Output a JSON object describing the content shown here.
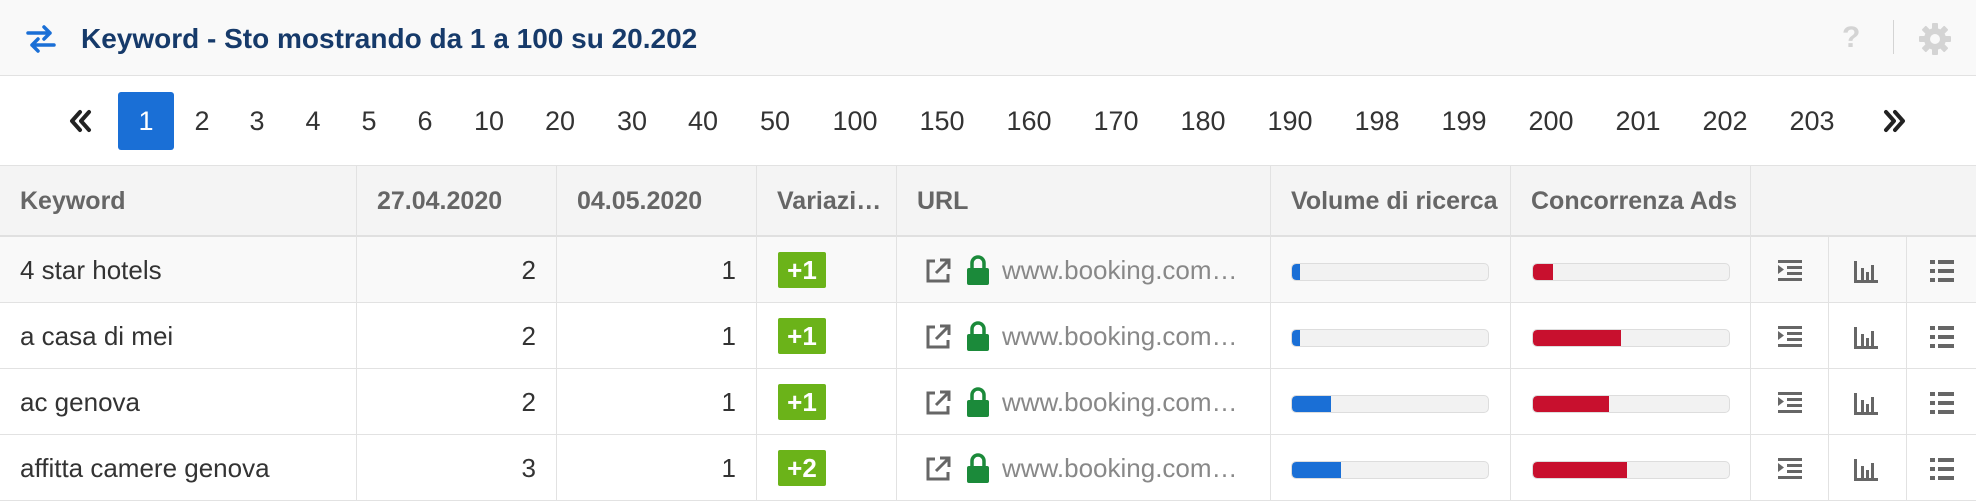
{
  "header": {
    "title": "Keyword - Sto mostrando da 1 a 100 su 20.202",
    "help": "?",
    "icons": [
      "swap-arrows-icon",
      "help-icon",
      "gear-icon"
    ]
  },
  "pagination": {
    "pages": [
      "1",
      "2",
      "3",
      "4",
      "5",
      "6",
      "10",
      "20",
      "30",
      "40",
      "50",
      "100",
      "150",
      "160",
      "170",
      "180",
      "190",
      "198",
      "199",
      "200",
      "201",
      "202",
      "203"
    ],
    "current": "1",
    "first_icon": "double-chevron-left-icon",
    "last_icon": "double-chevron-right-icon"
  },
  "table": {
    "columns": [
      "Keyword",
      "27.04.2020",
      "04.05.2020",
      "Variazione",
      "URL",
      "Volume di ricerca",
      "Concorrenza Ads"
    ],
    "rows": [
      {
        "keyword": "4 star hotels",
        "prev": "2",
        "curr": "1",
        "change": "+1",
        "url": "www.booking.com…",
        "volume": 0.04,
        "competition": 0.1
      },
      {
        "keyword": "a casa di mei",
        "prev": "2",
        "curr": "1",
        "change": "+1",
        "url": "www.booking.com…",
        "volume": 0.04,
        "competition": 0.45
      },
      {
        "keyword": "ac genova",
        "prev": "2",
        "curr": "1",
        "change": "+1",
        "url": "www.booking.com…",
        "volume": 0.2,
        "competition": 0.39
      },
      {
        "keyword": "affitta camere genova",
        "prev": "3",
        "curr": "1",
        "change": "+2",
        "url": "www.booking.com…",
        "volume": 0.25,
        "competition": 0.48
      }
    ],
    "row_icons": [
      "external-link-icon",
      "lock-icon",
      "indent-icon",
      "bar-chart-icon",
      "list-icon"
    ]
  },
  "colors": {
    "title": "#163a6a",
    "accent": "#1a6fd6",
    "badge": "#6bb319",
    "lock": "#1b8a3a",
    "competition": "#c8102e"
  }
}
